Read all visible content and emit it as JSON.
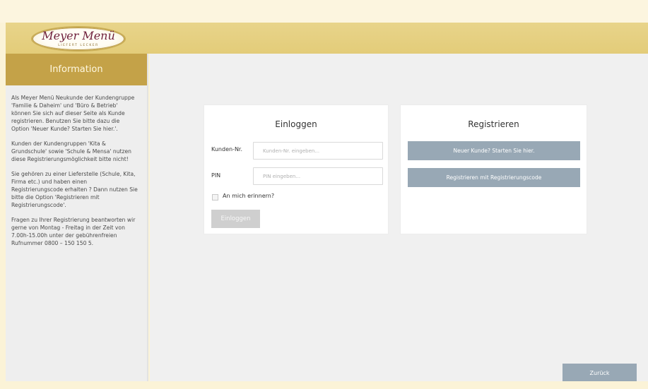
{
  "brand": {
    "logo_name": "Meyer Menü",
    "logo_tagline": "LIEFERT LECKER"
  },
  "sidebar": {
    "title": "Information",
    "paragraphs": [
      "Als Meyer Menü Neukunde der Kundengruppe 'Familie & Daheim' und 'Büro & Betrieb' können Sie sich auf dieser Seite als Kunde registrieren. Benutzen Sie bitte dazu die Option 'Neuer Kunde? Starten Sie hier.'.",
      "Kunden der Kundengruppen 'Kita & Grundschule' sowie 'Schule & Mensa' nutzen diese Registrierungsmöglichkeit bitte nicht!",
      "Sie gehören zu einer Lieferstelle (Schule, Kita, Firma etc.) und haben einen Registrierungscode erhalten ? Dann nutzen Sie bitte die Option 'Registrieren mit Registrierungscode'.",
      "Fragen zu Ihrer Registrierung beantworten wir gerne von Montag - Freitag in der Zeit von 7.00h-15.00h unter der gebührenfreien Rufnummer 0800 – 150 150 5."
    ]
  },
  "login": {
    "title": "Einloggen",
    "customer_label": "Kunden-Nr.",
    "customer_placeholder": "Kunden-Nr. eingeben...",
    "customer_value": "",
    "pin_label": "PIN",
    "pin_placeholder": "PIN eingeben...",
    "pin_value": "",
    "remember_label": "An mich erinnern?",
    "remember_checked": false,
    "submit_label": "Einloggen"
  },
  "register": {
    "title": "Registrieren",
    "new_customer_label": "Neuer Kunde? Starten Sie hier.",
    "code_label": "Registrieren mit Registrierungscode"
  },
  "footer": {
    "back_label": "Zurück"
  },
  "colors": {
    "header_gold": "#e5cf7f",
    "sidebar_title_gold": "#c4a248",
    "button_blue_grey": "#98a8b5",
    "button_disabled": "#cfcfcf",
    "logo_text": "#6e1f3b"
  }
}
